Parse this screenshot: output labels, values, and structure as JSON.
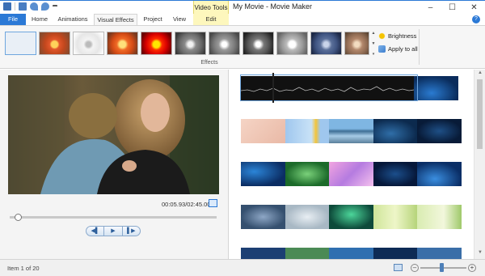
{
  "titlebar": {
    "title": "My Movie - Movie Maker",
    "context_tab": "Video Tools",
    "controls": {
      "minimize": "–",
      "maximize": "☐",
      "close": "✕"
    },
    "qat_icons": [
      "app-icon",
      "save-icon",
      "undo-icon",
      "redo-icon",
      "customize-qat-icon"
    ]
  },
  "ribbon_tabs": {
    "file": "File",
    "home": "Home",
    "animations": "Animations",
    "visual_effects": "Visual Effects",
    "project": "Project",
    "view": "View",
    "edit": "Edit",
    "help": "?"
  },
  "ribbon": {
    "effects_group_label": "Effects",
    "brightness": "Brightness",
    "apply_to_all": "Apply to all",
    "effects": [
      {
        "name": "no-effect",
        "selected": true
      },
      {
        "name": "warm"
      },
      {
        "name": "sketch"
      },
      {
        "name": "bloom"
      },
      {
        "name": "saturated"
      },
      {
        "name": "grayscale"
      },
      {
        "name": "black-and-white"
      },
      {
        "name": "black-and-white-contrast"
      },
      {
        "name": "black-and-white-high"
      },
      {
        "name": "blue-tint"
      },
      {
        "name": "sepia"
      }
    ]
  },
  "preview": {
    "timecode": "00:05.93/02:45.00",
    "progress_fraction": 0.04,
    "controls": {
      "previous_frame": "◀▌",
      "play": "▶",
      "next_frame": "▌▶"
    }
  },
  "status": {
    "text": "Item 1 of 20",
    "zoom_level_fraction": 0.45,
    "zoom_minus": "–",
    "zoom_plus": "+"
  },
  "colors": {
    "accent": "#2b79d6",
    "context_tab": "#fdf7bd",
    "selection": "#6fa6de"
  }
}
